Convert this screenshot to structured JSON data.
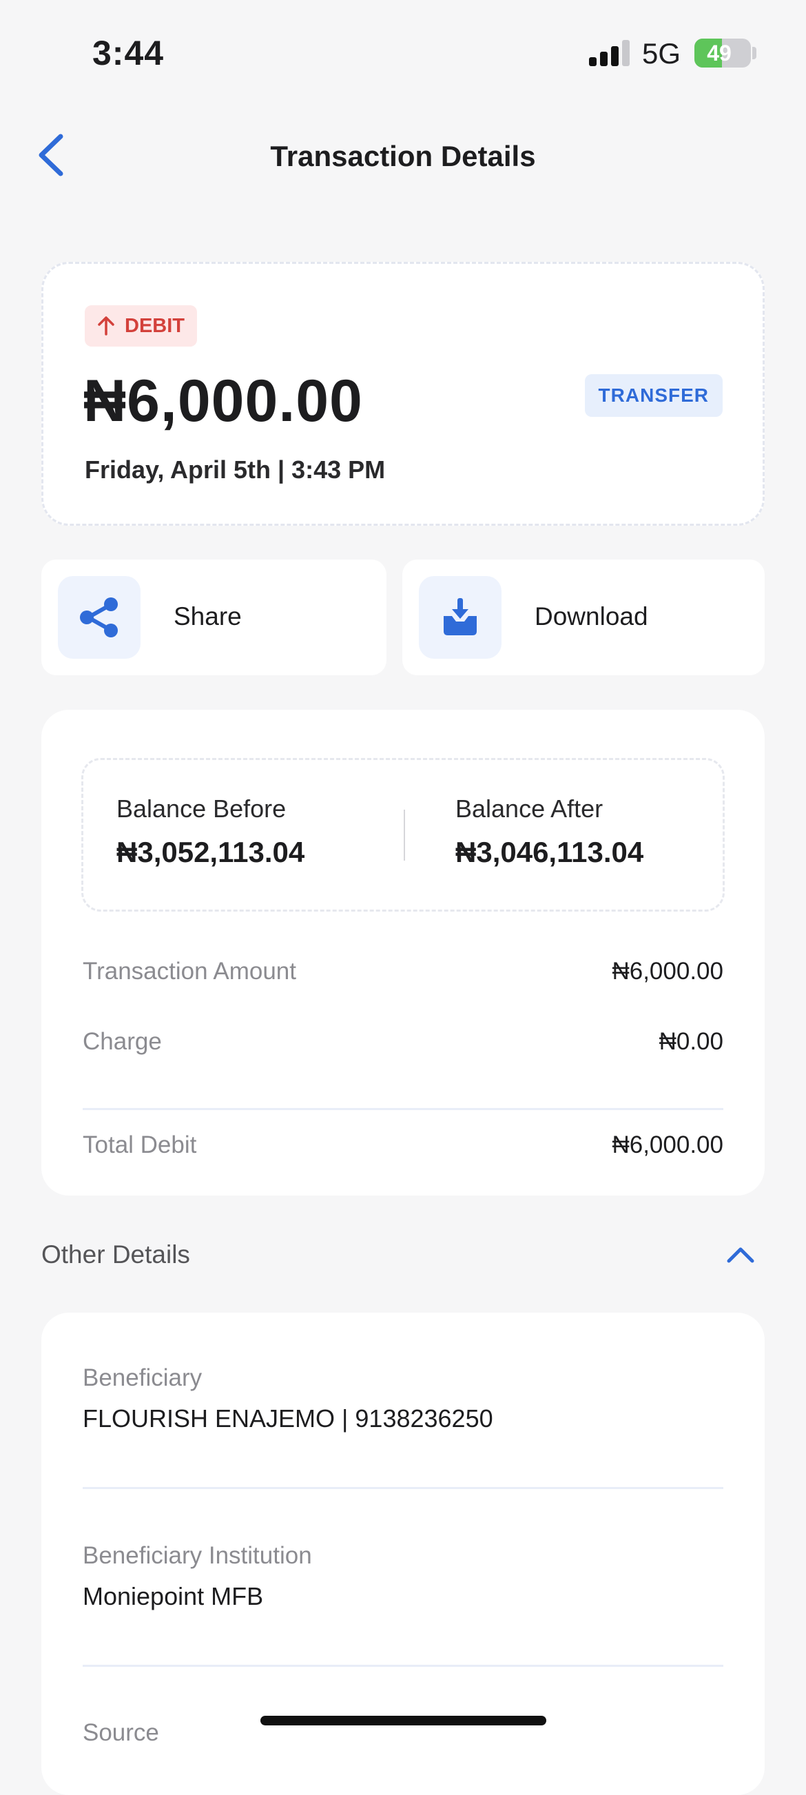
{
  "status_bar": {
    "time": "3:44",
    "network": "5G",
    "battery": "49",
    "battery_level": 0.49,
    "icons": [
      "cellular-signal-icon",
      "battery-charging-icon"
    ]
  },
  "nav": {
    "title": "Transaction Details",
    "back_icon": "chevron-left-icon"
  },
  "hero": {
    "badge_label": "DEBIT",
    "badge_icon": "arrow-up-icon",
    "amount": "₦6,000.00",
    "type_label": "TRANSFER",
    "date": "Friday, April 5th | 3:43 PM"
  },
  "actions": {
    "share_label": "Share",
    "share_icon": "share-icon",
    "download_label": "Download",
    "download_icon": "download-icon"
  },
  "summary": {
    "balance_before_label": "Balance Before",
    "balance_before_value": "₦3,052,113.04",
    "balance_after_label": "Balance After",
    "balance_after_value": "₦3,046,113.04",
    "rows": [
      {
        "label": "Transaction Amount",
        "value": "₦6,000.00"
      },
      {
        "label": "Charge",
        "value": "₦0.00"
      },
      {
        "label": "Total Debit",
        "value": "₦6,000.00"
      }
    ]
  },
  "other_details": {
    "title": "Other Details",
    "toggle_icon": "chevron-up-icon",
    "items": [
      {
        "label": "Beneficiary",
        "value": "FLOURISH ENAJEMO | 9138236250"
      },
      {
        "label": "Beneficiary Institution",
        "value": "Moniepoint MFB"
      },
      {
        "label": "Source",
        "value": ""
      }
    ]
  },
  "colors": {
    "accent": "#2f6bd8",
    "debit": "#d3413b",
    "background": "#f6f6f7",
    "battery": "#5ec55a"
  }
}
